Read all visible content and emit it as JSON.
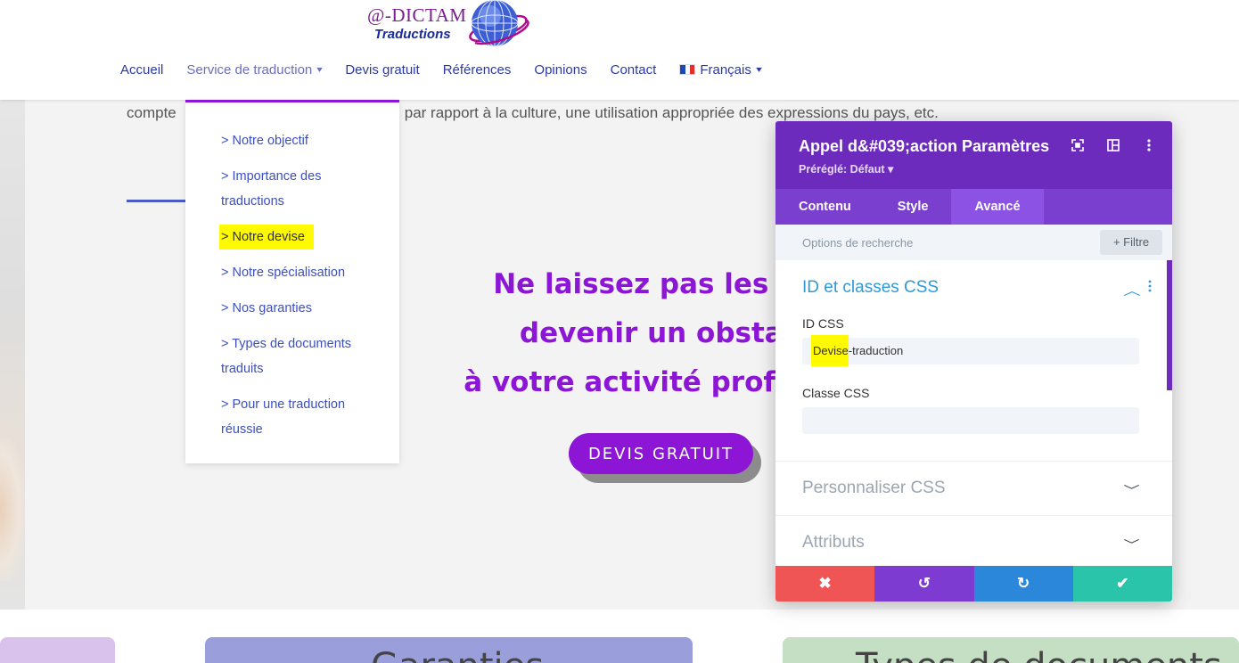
{
  "logo": {
    "line1": "@-DICTAM",
    "line2": "Traductions"
  },
  "nav": {
    "items": [
      {
        "label": "Accueil"
      },
      {
        "label": "Service de traduction",
        "chevron": "⌄"
      },
      {
        "label": "Devis gratuit"
      },
      {
        "label": "Références"
      },
      {
        "label": "Opinions"
      },
      {
        "label": "Contact"
      },
      {
        "label": "Français",
        "chevron": "⌄"
      }
    ]
  },
  "dropdown": {
    "items": [
      {
        "label": "> Notre objectif"
      },
      {
        "label": "> Importance des traductions"
      },
      {
        "label": "> Notre devise",
        "highlighted": true
      },
      {
        "label": "> Notre spécialisation"
      },
      {
        "label": "> Nos garanties"
      },
      {
        "label": "> Types de documents traduits"
      },
      {
        "label": "> Pour une traduction réussie"
      }
    ]
  },
  "content": {
    "intro_left": "compte",
    "intro_right": "par rapport à la culture, une utilisation appropriée des expressions du pays, etc.",
    "headline": [
      "Ne laissez pas les lan",
      "devenir un obstac",
      "à votre activité professio"
    ],
    "cta_label": "DEVIS GRATUIT"
  },
  "bottom_cards": [
    {
      "text": ""
    },
    {
      "text": "Garanties"
    },
    {
      "text": "Types de documents"
    }
  ],
  "panel": {
    "title": "Appel d&#039;action Paramètres",
    "preset": "Préréglé: Défaut ▾",
    "icons": {
      "expand": "expand-icon",
      "layout": "layout-icon",
      "more": "more-icon"
    },
    "tabs": [
      {
        "label": "Contenu"
      },
      {
        "label": "Style"
      },
      {
        "label": "Avancé",
        "active": true
      }
    ],
    "search_placeholder": "Options de recherche",
    "filter_label": "+ Filtre",
    "section_css": {
      "title": "ID et classes CSS",
      "id_label": "ID CSS",
      "id_value_highlight": "Devise",
      "id_value_rest": "-traduction",
      "class_label": "Classe CSS",
      "class_value": ""
    },
    "section_custom_css": {
      "title": "Personnaliser CSS"
    },
    "section_attributes": {
      "title": "Attributs"
    },
    "footer": {
      "cancel": "✖",
      "undo": "↺",
      "redo": "↻",
      "save": "✔",
      "colors": {
        "cancel": "#ef5555",
        "undo": "#7d3bd1",
        "redo": "#2b87da",
        "save": "#29c4a9"
      }
    }
  },
  "colors": {
    "accent_purple": "#8d15d6",
    "nav_blue": "#2b3aa6",
    "panel_purple": "#6d2bbd",
    "highlight": "#fffa00"
  }
}
